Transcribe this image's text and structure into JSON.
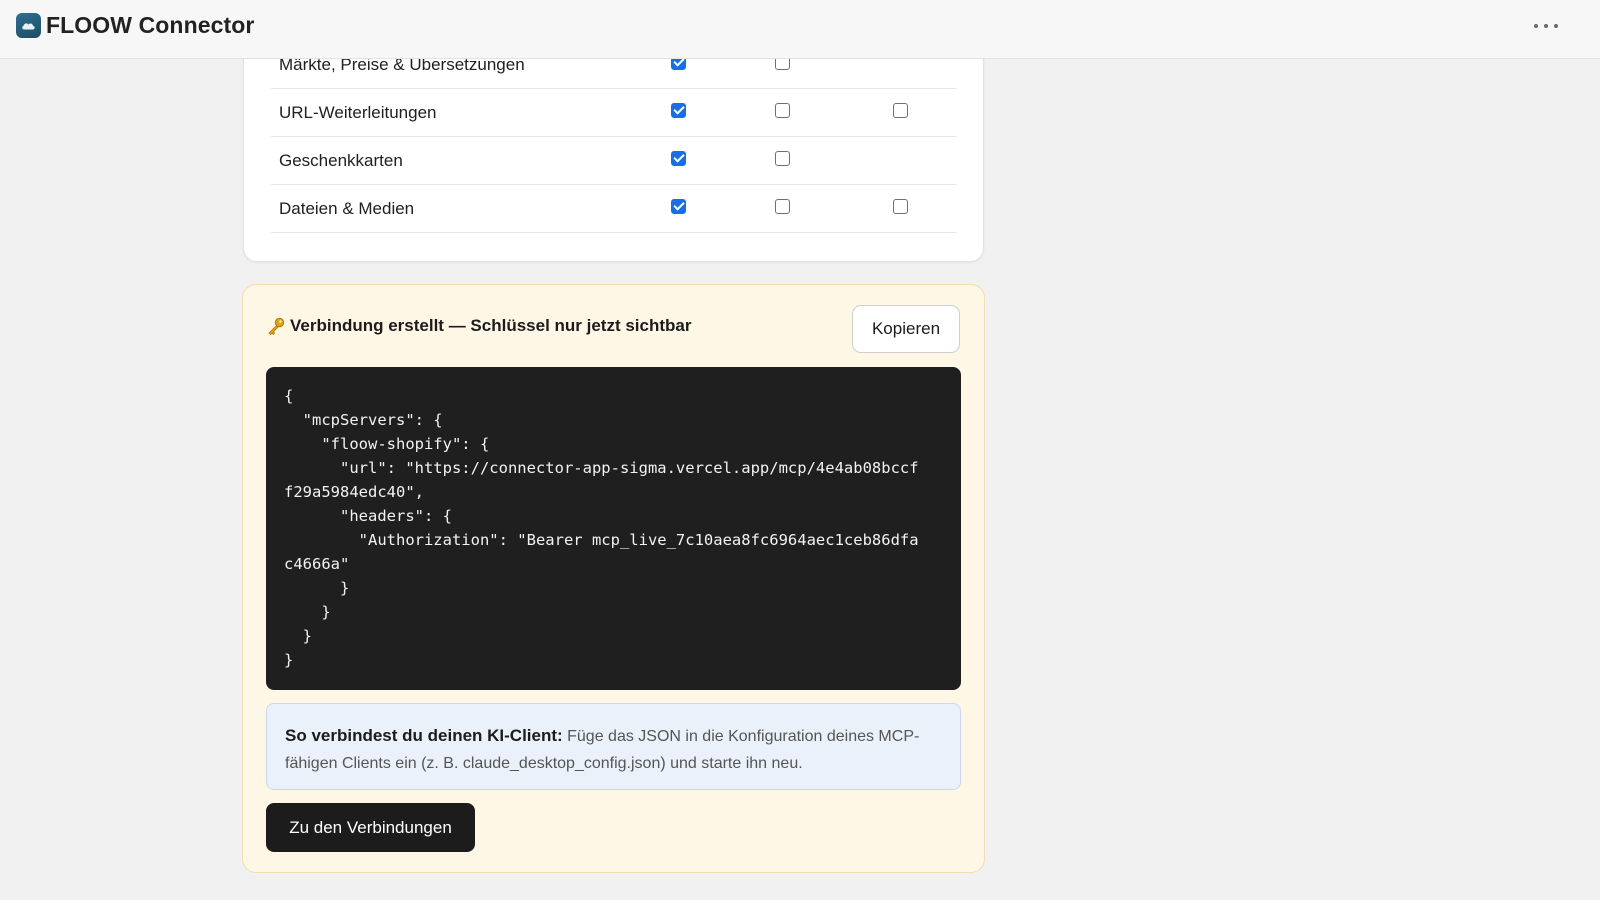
{
  "app": {
    "title": "FLOOW Connector",
    "logo_icon": "cloud-logo-icon",
    "menu_icon": "more-horizontal-icon"
  },
  "permissions": {
    "rows": [
      {
        "label": "Märkte, Preise & Übersetzungen",
        "read": true,
        "write": false,
        "delete": null
      },
      {
        "label": "URL-Weiterleitungen",
        "read": true,
        "write": false,
        "delete": false
      },
      {
        "label": "Geschenkkarten",
        "read": true,
        "write": false,
        "delete": null
      },
      {
        "label": "Dateien & Medien",
        "read": true,
        "write": false,
        "delete": false
      }
    ]
  },
  "connection": {
    "icon": "key-icon",
    "title": "Verbindung erstellt — Schlüssel nur jetzt sichtbar",
    "copy_label": "Kopieren",
    "code": "{\n  \"mcpServers\": {\n    \"floow-shopify\": {\n      \"url\": \"https://connector-app-sigma.vercel.app/mcp/4e4ab08bccf\nf29a5984edc40\",\n      \"headers\": {\n        \"Authorization\": \"Bearer mcp_live_7c10aea8fc6964aec1ceb86dfa\nc4666a\"\n      }\n    }\n  }\n}",
    "info_strong": "So verbindest du deinen KI-Client:",
    "info_text": " Füge das JSON in die Konfiguration deines MCP-fähigen Clients ein (z. B. claude_desktop_config.json) und starte ihn neu.",
    "primary_label": "Zu den Verbindungen"
  },
  "colors": {
    "checkbox_checked": "#1a6fe0",
    "notice_background": "#fff7e6",
    "code_background": "#1f1f1f",
    "info_background": "#eaf1fb",
    "primary_button": "#1c1c1c"
  }
}
